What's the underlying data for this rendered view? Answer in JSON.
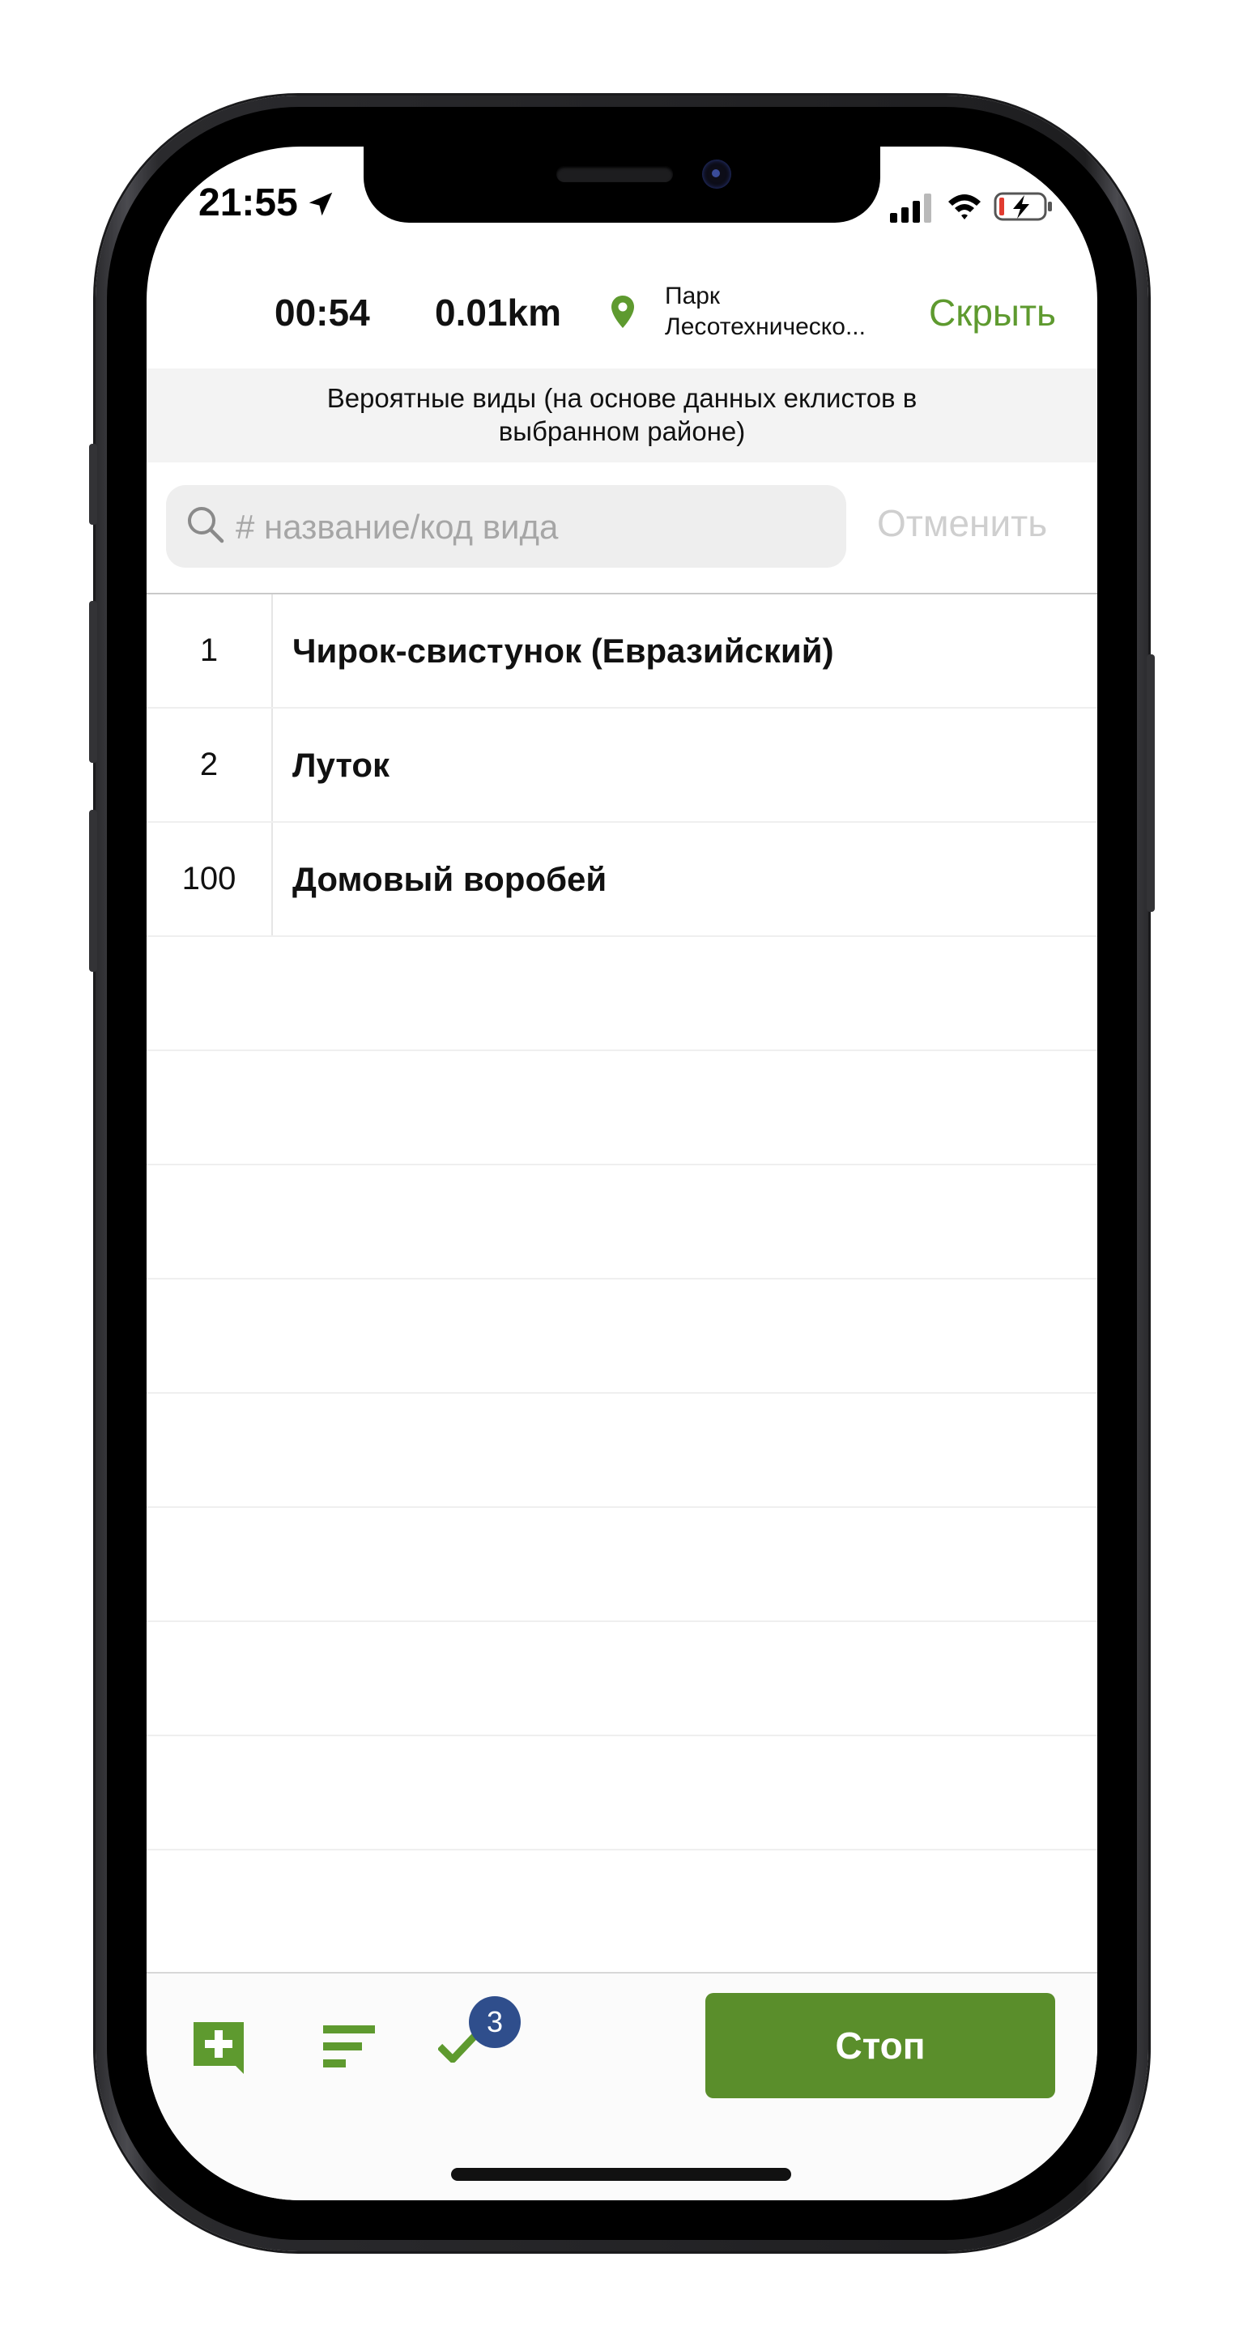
{
  "status_bar": {
    "time": "21:55"
  },
  "header": {
    "timer": "00:54",
    "distance": "0.01km",
    "location_line1": "Парк",
    "location_line2": "Лесотехническо...",
    "hide_label": "Скрыть"
  },
  "banner": {
    "line1": "Вероятные виды (на основе данных  еклистов в",
    "line2": "выбранном районе)"
  },
  "search": {
    "placeholder": "# название/код вида",
    "cancel_label": "Отменить"
  },
  "species": [
    {
      "count": "1",
      "name": "Чирок-свистунок (Евразийский)"
    },
    {
      "count": "2",
      "name": "Луток"
    },
    {
      "count": "100",
      "name": "Домовый воробей"
    }
  ],
  "toolbar": {
    "checked_count": "3",
    "stop_label": "Стоп"
  },
  "colors": {
    "accent_green": "#5a8e2b",
    "link_green": "#5e9a2f",
    "badge_blue": "#2f4e8c"
  }
}
